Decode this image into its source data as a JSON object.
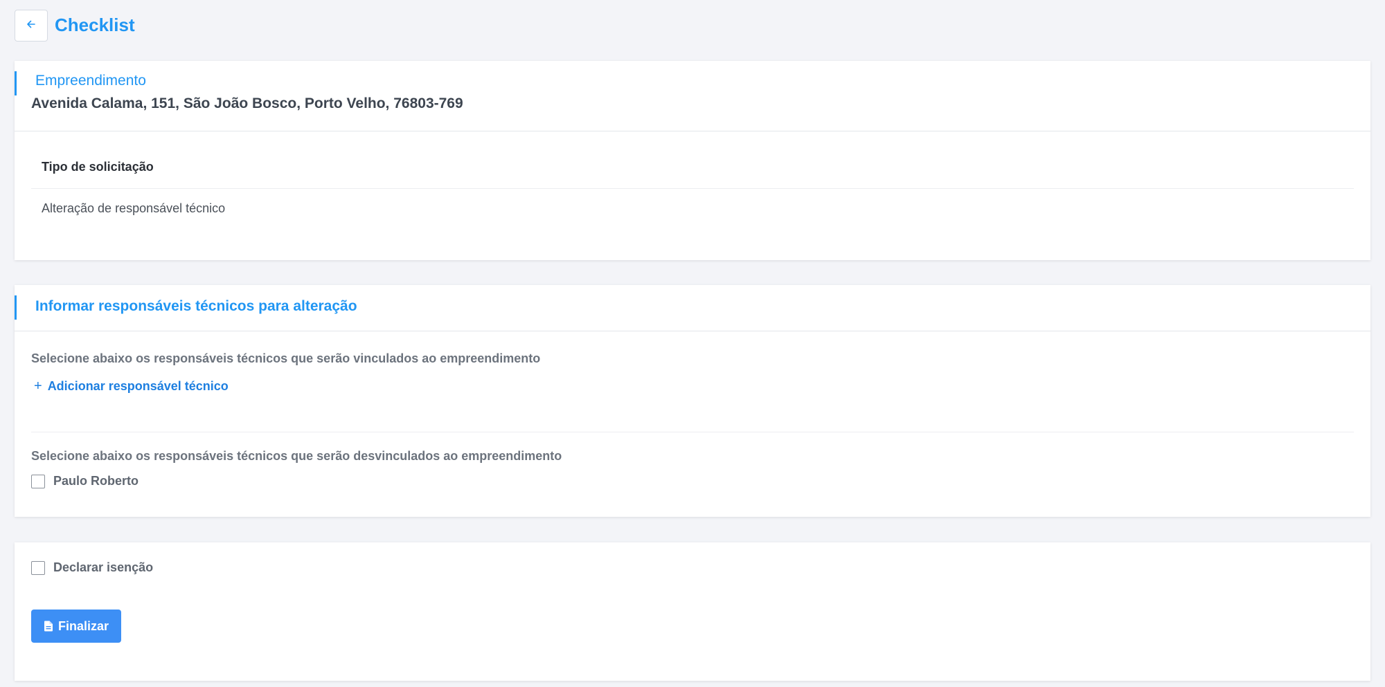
{
  "header": {
    "title": "Checklist",
    "back_icon": "arrow-left-icon"
  },
  "empreendimento": {
    "title": "Empreendimento",
    "address": "Avenida Calama, 151, São João Bosco, Porto Velho, 76803-769",
    "type_label": "Tipo de solicitação",
    "type_value": "Alteração de responsável técnico"
  },
  "responsaveis": {
    "title": "Informar responsáveis técnicos para alteração",
    "link_hint": "Selecione abaixo os responsáveis técnicos que serão vinculados ao empreendimento",
    "add_label": "Adicionar responsável técnico",
    "unlink_hint": "Selecione abaixo os responsáveis técnicos que serão desvinculados ao empreendimento",
    "existing": [
      {
        "name": "Paulo Roberto",
        "checked": false
      }
    ]
  },
  "footer": {
    "exemption_label": "Declarar isenção",
    "exemption_checked": false,
    "finalize_label": "Finalizar",
    "finalize_icon": "document-icon"
  },
  "colors": {
    "accent": "#2196f3",
    "button": "#3d8ff5",
    "background": "#f3f4f8"
  }
}
